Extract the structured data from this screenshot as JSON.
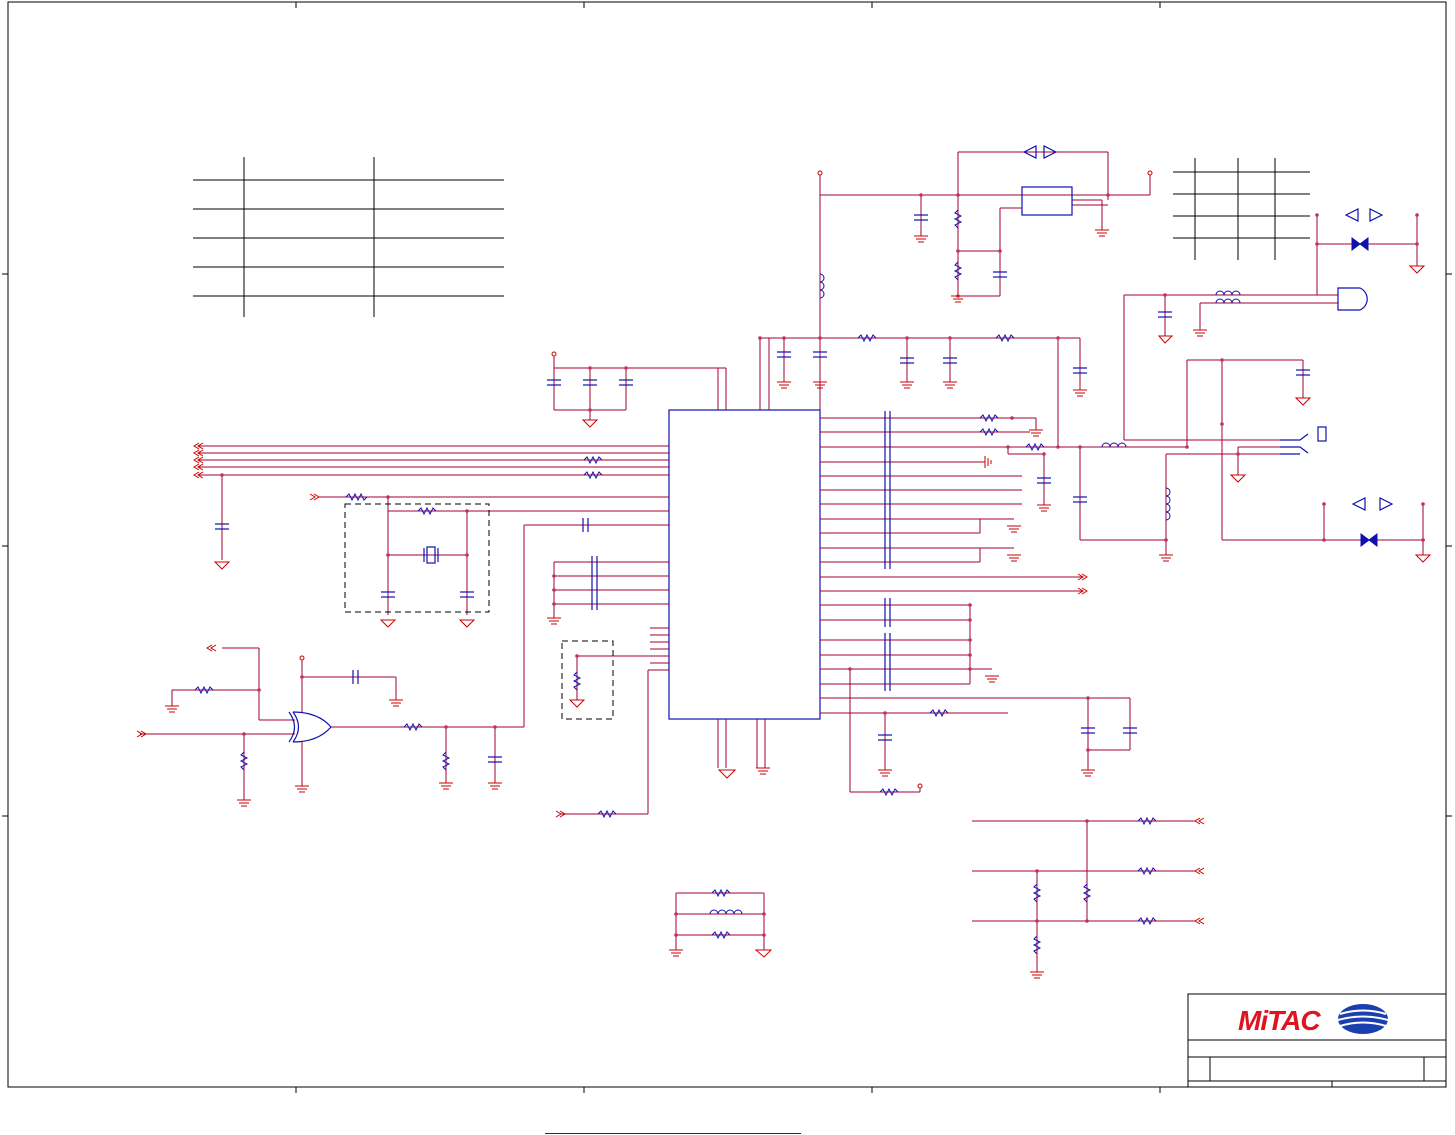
{
  "title_block": {
    "company_logo": "MiTAC",
    "emblem_icon": "globe-emblem-icon"
  },
  "colors": {
    "wire": "#a00030",
    "component": "#1010b0",
    "ground": "#cc0000",
    "frame": "#000000",
    "logo_red": "#e0141e",
    "logo_blue": "#1a3fb0"
  }
}
